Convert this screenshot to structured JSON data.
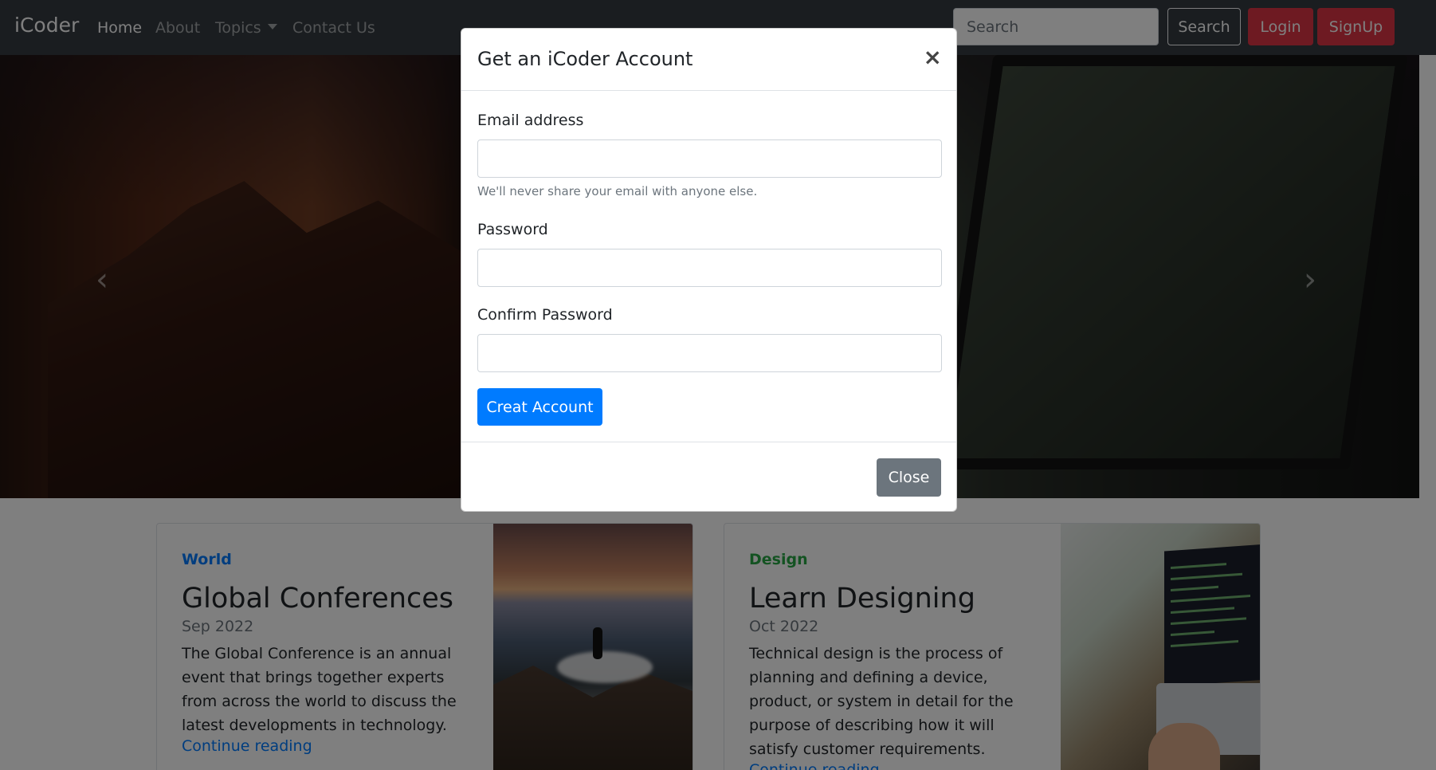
{
  "navbar": {
    "brand": "iCoder",
    "links": [
      "Home",
      "About",
      "Topics",
      "Contact Us"
    ],
    "search_placeholder": "Search",
    "search_button": "Search",
    "login_button": "Login",
    "signup_button": "SignUp"
  },
  "carousel": {
    "prev_icon": "chevron-left-icon",
    "next_icon": "chevron-right-icon"
  },
  "cards": [
    {
      "category": "World",
      "category_color": "#007bff",
      "title": "Global Conferences",
      "date": "Sep 2022",
      "text": "The Global Conference is an annual event that brings together experts from across the world to discuss the latest developments in technology.",
      "link": "Continue reading"
    },
    {
      "category": "Design",
      "category_color": "#28a745",
      "title": "Learn Designing",
      "date": "Oct 2022",
      "text": "Technical design is the process of planning and defining a device, product, or system in detail for the purpose of describing how it will satisfy customer requirements.",
      "link": "Continue reading"
    }
  ],
  "modal": {
    "title": "Get an iCoder Account",
    "close_icon": "×",
    "email_label": "Email address",
    "email_help": "We'll never share your email with anyone else.",
    "password_label": "Password",
    "confirm_label": "Confirm Password",
    "submit_button": "Creat Account",
    "close_button": "Close"
  },
  "colors": {
    "navbar_bg": "#343a40",
    "primary": "#007bff",
    "danger": "#dc3545",
    "secondary": "#6c757d",
    "success": "#28a745"
  }
}
